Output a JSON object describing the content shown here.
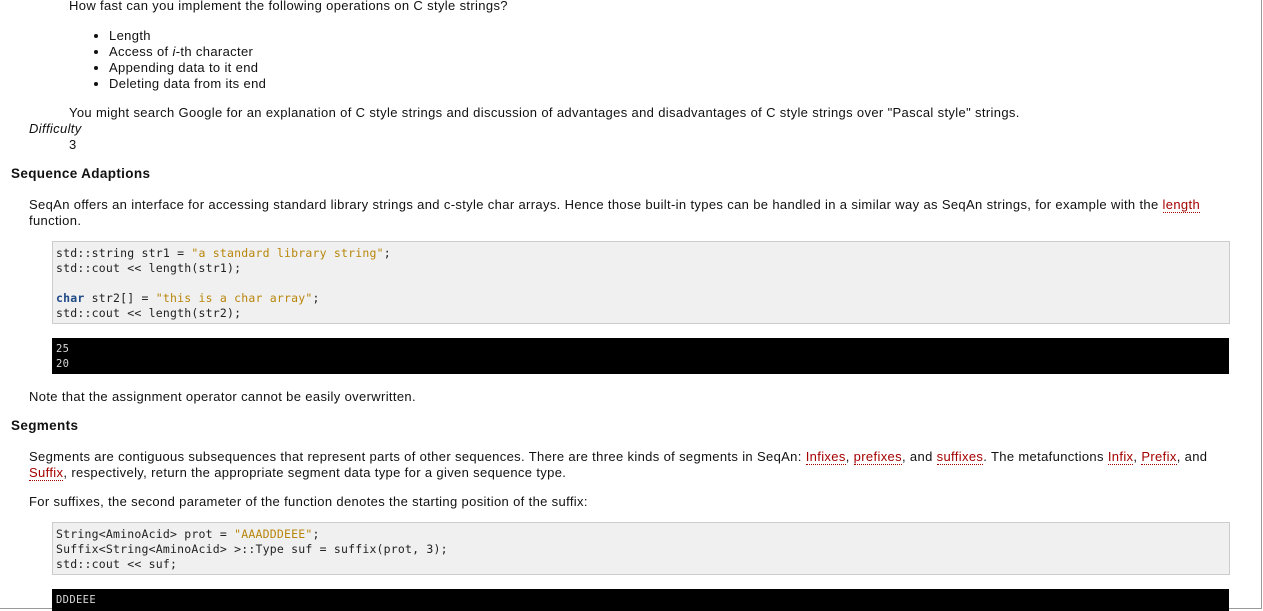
{
  "intro_question": "How fast can you implement the following operations on C style strings?",
  "operations": [
    {
      "pre": "Length",
      "em": "",
      "post": ""
    },
    {
      "pre": "Access of ",
      "em": "i",
      "post": "-th character"
    },
    {
      "pre": "Appending data to it end",
      "em": "",
      "post": ""
    },
    {
      "pre": "Deleting data from its end",
      "em": "",
      "post": ""
    }
  ],
  "search_note": "You might search Google for an explanation of C style strings and discussion of advantages and disadvantages of C style strings over \"Pascal style\" strings.",
  "difficulty": {
    "label": "Difficulty",
    "value": "3"
  },
  "sequence_adaptions": {
    "heading": "Sequence Adaptions",
    "para_before": "SeqAn offers an interface for accessing standard library strings and c-style char arrays. Hence those built-in types can be handled in a similar way as SeqAn strings, for example with the ",
    "link": "length",
    "para_after": " function.",
    "code": {
      "l1_a": "std::string str1 = ",
      "l1_str": "\"a standard library string\"",
      "l1_b": ";",
      "l2": "std::cout << length(str1);",
      "l3_kw": "char",
      "l3_a": " str2[] = ",
      "l3_str": "\"this is a char array\"",
      "l3_b": ";",
      "l4": "std::cout << length(str2);"
    },
    "output": [
      "25",
      "20"
    ],
    "note": "Note that the assignment operator cannot be easily overwritten."
  },
  "segments": {
    "heading": "Segments",
    "p1_a": "Segments are contiguous subsequences that represent parts of other sequences. There are three kinds of segments in SeqAn: ",
    "link_infixes": "Infixes",
    "p1_b": ", ",
    "link_prefixes": "prefixes",
    "p1_c": ", and ",
    "link_suffixes": "suffixes",
    "p1_d": ". The metafunctions ",
    "link_infix": "Infix",
    "p1_e": ", ",
    "link_prefix": "Prefix",
    "p1_f": ", and ",
    "link_suffix": "Suffix",
    "p1_g": ", respectively, return the appropriate segment data type for a given sequence type.",
    "p2": "For suffixes, the second parameter of the function denotes the starting position of the suffix:",
    "code": {
      "l1_a": "String<AminoAcid> prot = ",
      "l1_str": "\"AAADDDEEE\"",
      "l1_b": ";",
      "l2": "Suffix<String<AminoAcid> >::Type suf = suffix(prot, 3);",
      "l3": "std::cout << suf;"
    },
    "output": [
      "DDDEEE"
    ]
  }
}
